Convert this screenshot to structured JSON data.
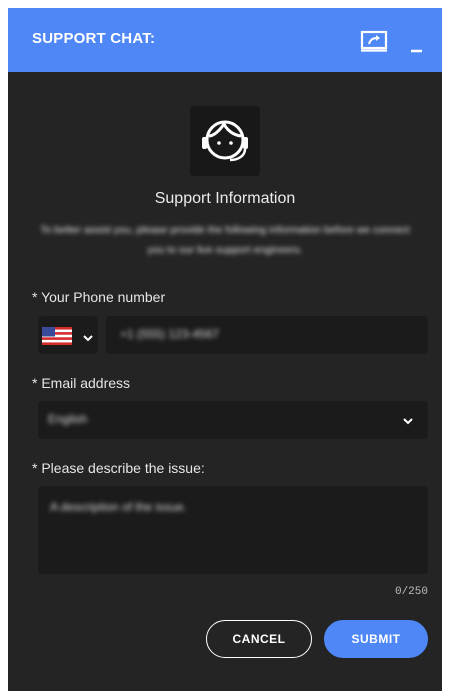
{
  "header": {
    "title": "SUPPORT CHAT:",
    "popout_icon": "popout-window-icon",
    "minimize_icon": "minimize-icon",
    "color": "#4f87f6"
  },
  "intro": {
    "avatar_icon": "headset-agent-icon",
    "title": "Support Information",
    "description": "To better assist you, please provide the following information before we connect you to our live support engineers."
  },
  "form": {
    "phone": {
      "label": "* Your Phone number",
      "country_flag_icon": "us-flag-icon",
      "value": "+1 (555) 123-4567"
    },
    "email": {
      "label": "* Email address",
      "selected": "English"
    },
    "issue": {
      "label": "* Please describe the issue:",
      "placeholder": "A description of the issue.",
      "counter": "0/250"
    }
  },
  "actions": {
    "cancel_label": "CANCEL",
    "submit_label": "SUBMIT"
  }
}
